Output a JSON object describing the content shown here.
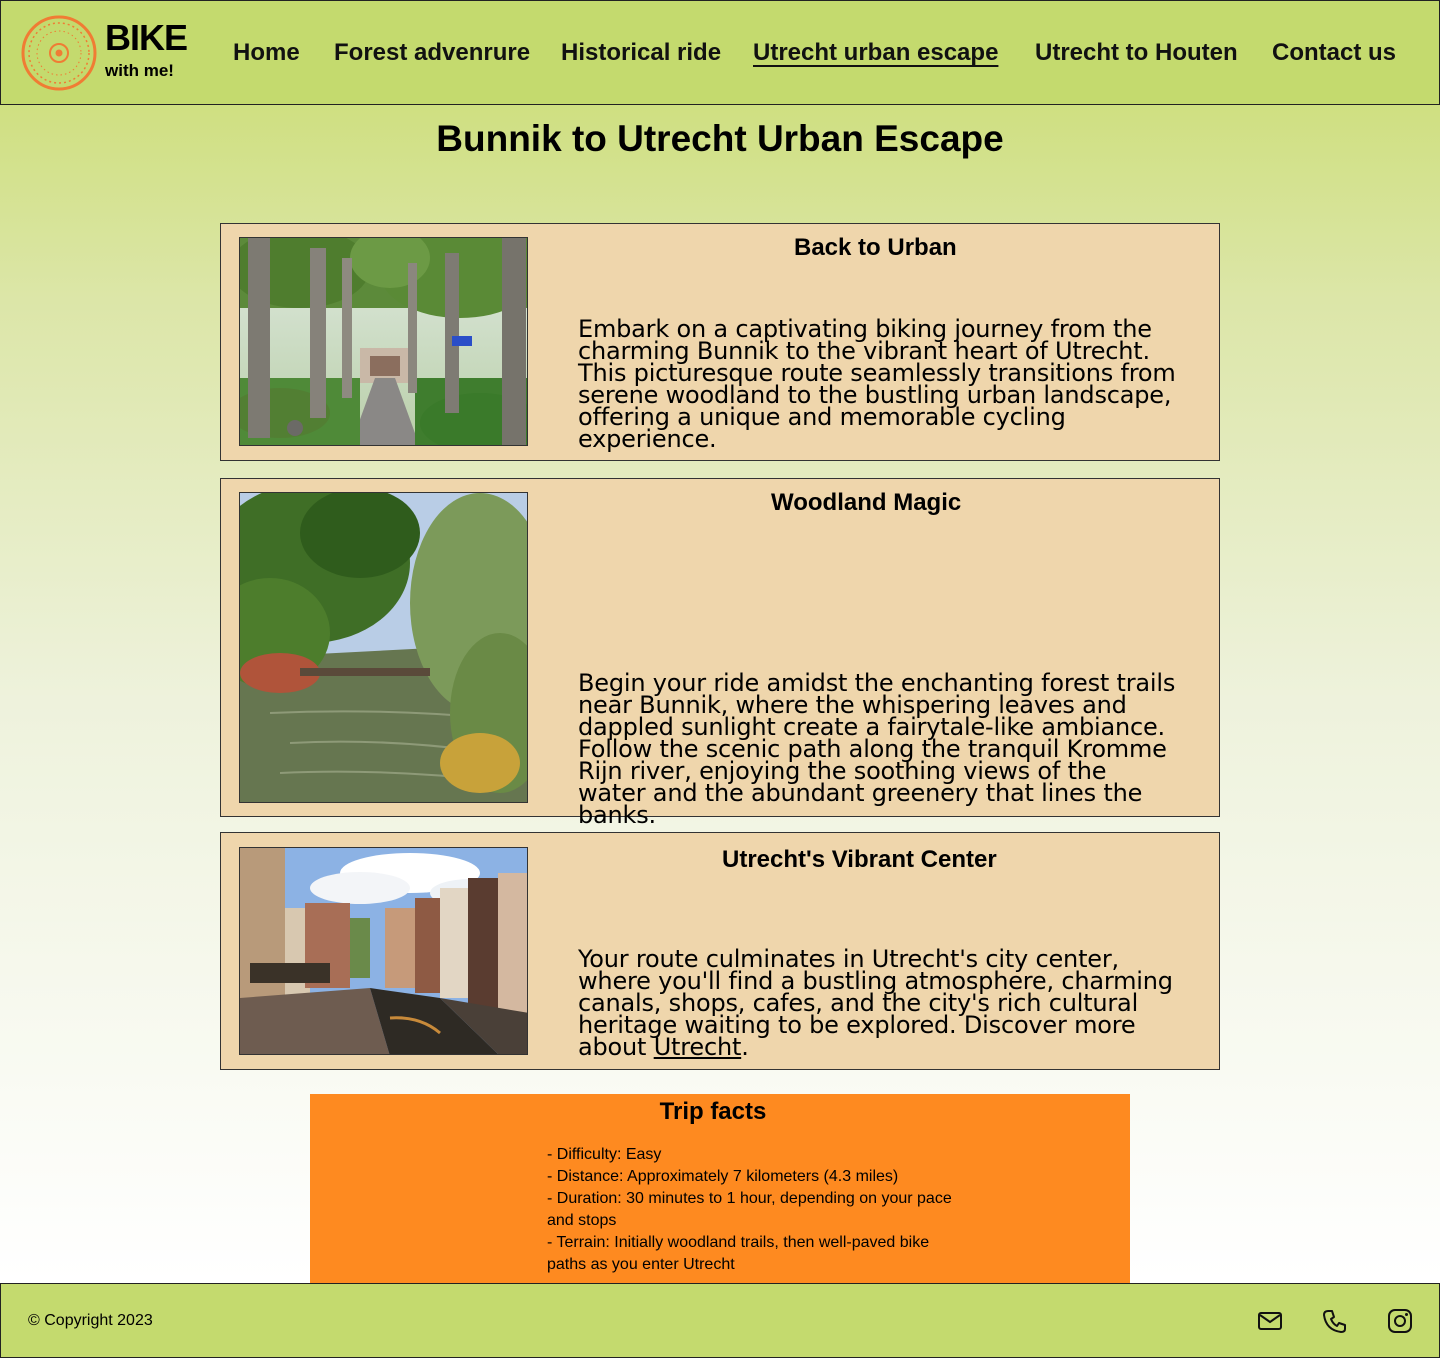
{
  "header": {
    "logo": {
      "line1": "BIKE",
      "line2": "with me!",
      "accent": "#f07c34"
    },
    "nav": [
      {
        "label": "Home"
      },
      {
        "label": "Forest advenrure"
      },
      {
        "label": "Historical ride"
      },
      {
        "label": "Utrecht urban escape",
        "active": true
      },
      {
        "label": "Utrecht to Houten"
      },
      {
        "label": "Contact us"
      }
    ]
  },
  "page": {
    "title": "Bunnik to Utrecht Urban Escape"
  },
  "cards": [
    {
      "title": "Back to Urban",
      "text": "Embark on a captivating biking journey from the charming Bunnik to the vibrant heart of Utrecht. This picturesque route seamlessly transitions from serene woodland to the bustling urban landscape, offering a unique and memorable cycling experience."
    },
    {
      "title": "Woodland Magic",
      "text": "Begin your ride amidst the enchanting forest trails near Bunnik, where the whispering leaves and dappled sunlight create a fairytale-like ambiance. Follow the scenic path along the tranquil Kromme Rijn river, enjoying the soothing views of the water and the abundant greenery that lines the banks."
    },
    {
      "title": "Utrecht's Vibrant Center",
      "text_before": "Your route culminates in Utrecht's city center, where you'll find a bustling atmosphere, charming canals, shops, cafes, and the city's rich cultural heritage waiting to be explored. Discover more about ",
      "link": "Utrecht",
      "text_after": "."
    }
  ],
  "facts": {
    "title": "Trip facts",
    "items": [
      "- Difficulty: Easy",
      "-  Distance: Approximately 7 kilometers (4.3 miles)",
      "- Duration: 30 minutes to 1 hour, depending on your pace and stops",
      "- Terrain: Initially woodland trails, then well-paved bike paths as you enter Utrecht"
    ],
    "background": "#fe8a20"
  },
  "footer": {
    "copyright": "© Copyright 2023",
    "icons": [
      "mail-icon",
      "phone-icon",
      "instagram-icon"
    ]
  },
  "colors": {
    "header_bg": "#c4da6e",
    "card_bg": "#efd6ac"
  }
}
